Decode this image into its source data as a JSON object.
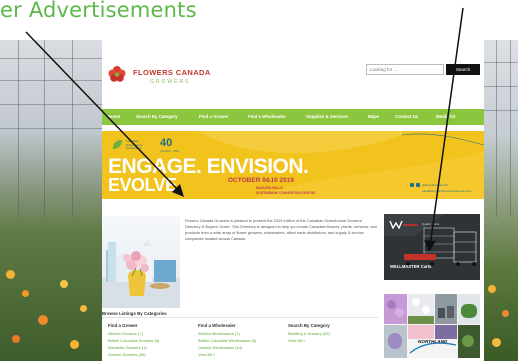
{
  "callout": {
    "text": "er Advertisements",
    "color": "#5db84a"
  },
  "site": {
    "logo": {
      "name": "FLOWERS CANADA",
      "tagline": "GROWERS"
    },
    "search": {
      "placeholder": "Looking for ...",
      "button": "Search"
    },
    "nav": {
      "color": "#8cc63f",
      "items": [
        "Home",
        "Search By Category",
        "Find a Grower",
        "Find a Wholesaler",
        "Supplies & Services",
        "Maps",
        "Contact Us",
        "Media Kit"
      ]
    },
    "banner": {
      "org_line1": "Canadian",
      "org_line2": "Greenhouse",
      "org_line3": "Conference",
      "anniversary": "40",
      "anniversary_sub": "YEARS · ANS",
      "headline1": "ENGAGE. ENVISION.",
      "headline2": "EVOLVE.",
      "date": "OCTOBER 9&10 2019",
      "venue1": "NIAGARA FALLS",
      "venue2": "SCOTIABANK CONVENTION CENTRE",
      "social": "@GreenhouseConf",
      "url": "canadiangreenhouseconference.com",
      "color": "#f2c21d"
    },
    "intro": {
      "text": "Flowers Canada Growers is pleased to present the 2019 edition of the Canadian Greenhouse Growers' Directory & Buyers' Guide. This Directory is designed to help you locate Canadian flowers, plants, services, and products from a wide array of flower growers, wholesalers, allied trade distributors, and supply & service companies located across Canada."
    },
    "ads": {
      "wellmaster": {
        "brand": "WELLMASTER Carts",
        "tag": "Quality Carts"
      },
      "northland": {
        "brand": "NORTHLAND"
      }
    },
    "listings": {
      "title": "Browse Listings By Categories",
      "columns": [
        {
          "heading": "Find a Grower",
          "links": [
            "Alberta Growers (7)",
            "British Columbia Growers (5)",
            "Manitoba Growers (1)",
            "Ontario Growers (46)"
          ]
        },
        {
          "heading": "Find a Wholesaler",
          "links": [
            "Alberta Wholesalers (1)",
            "British Columbia Wholesalers (5)",
            "Ontario Wholesalers (14)",
            "View All »"
          ]
        },
        {
          "heading": "Search By Category",
          "links": [
            "Bedding & Nursery (83)",
            "View All »"
          ]
        }
      ]
    }
  }
}
